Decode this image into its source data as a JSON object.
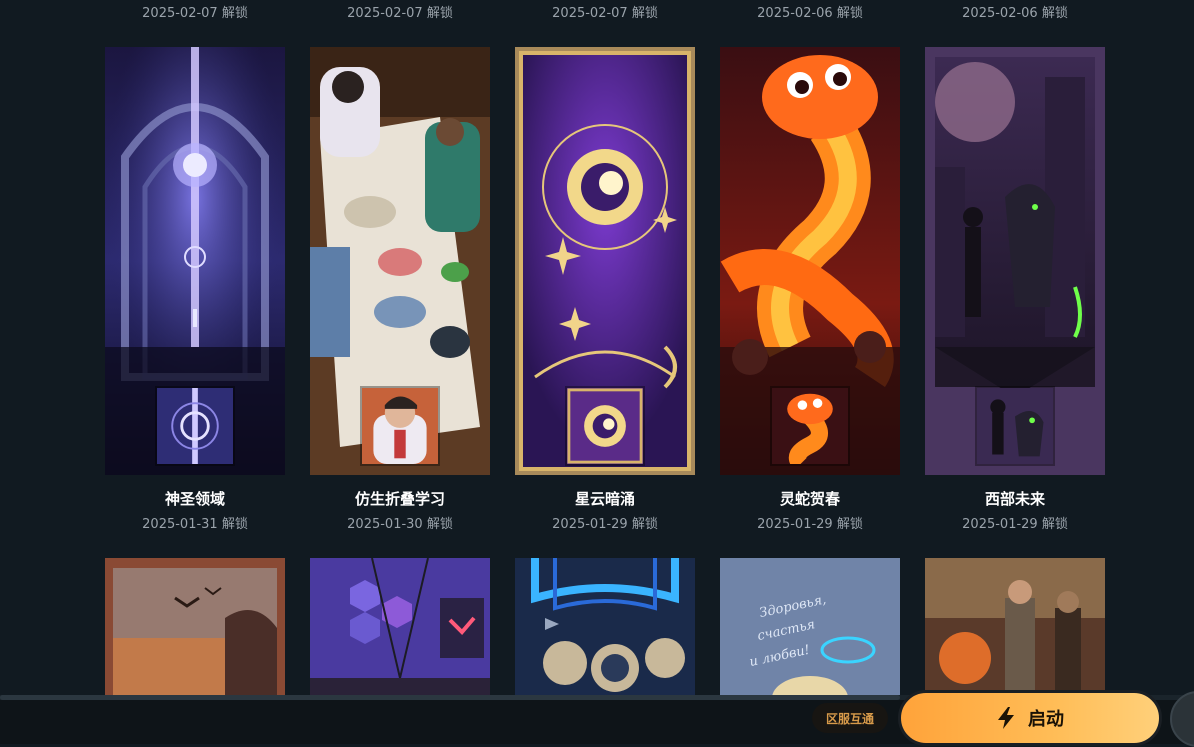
{
  "top_row_dates": [
    "2025-02-07 解锁",
    "2025-02-07 解锁",
    "2025-02-07 解锁",
    "2025-02-06 解锁",
    "2025-02-06 解锁"
  ],
  "cards": [
    {
      "title": "神圣领域",
      "date": "2025-01-31 解锁",
      "theme": "#3c3a8a",
      "icon": "sacred-realm-icon"
    },
    {
      "title": "仿生折叠学习",
      "date": "2025-01-30 解锁",
      "theme": "#6b4a2e",
      "icon": "bionic-folding-icon"
    },
    {
      "title": "星云暗涌",
      "date": "2025-01-29 解锁",
      "theme": "#4a2a86",
      "icon": "nebula-surge-icon"
    },
    {
      "title": "灵蛇贺春",
      "date": "2025-01-29 解锁",
      "theme": "#c73a1a",
      "icon": "spirit-snake-icon"
    },
    {
      "title": "西部未来",
      "date": "2025-01-29 解锁",
      "theme": "#3a2a52",
      "icon": "western-future-icon"
    }
  ],
  "bottom_row_artwork": [
    "canyon-birds-art",
    "hex-wall-room-art",
    "neon-ships-art",
    "russian-greeting-art",
    "desert-duel-art"
  ],
  "bottom_card_texts": {
    "greeting": [
      "Здоровья,",
      "счастья",
      "и любви!"
    ]
  },
  "footer": {
    "region_label": "区服互通",
    "launch_label": "启动"
  },
  "colors": {
    "accent": "#ffa33a",
    "background": "#111a21"
  }
}
